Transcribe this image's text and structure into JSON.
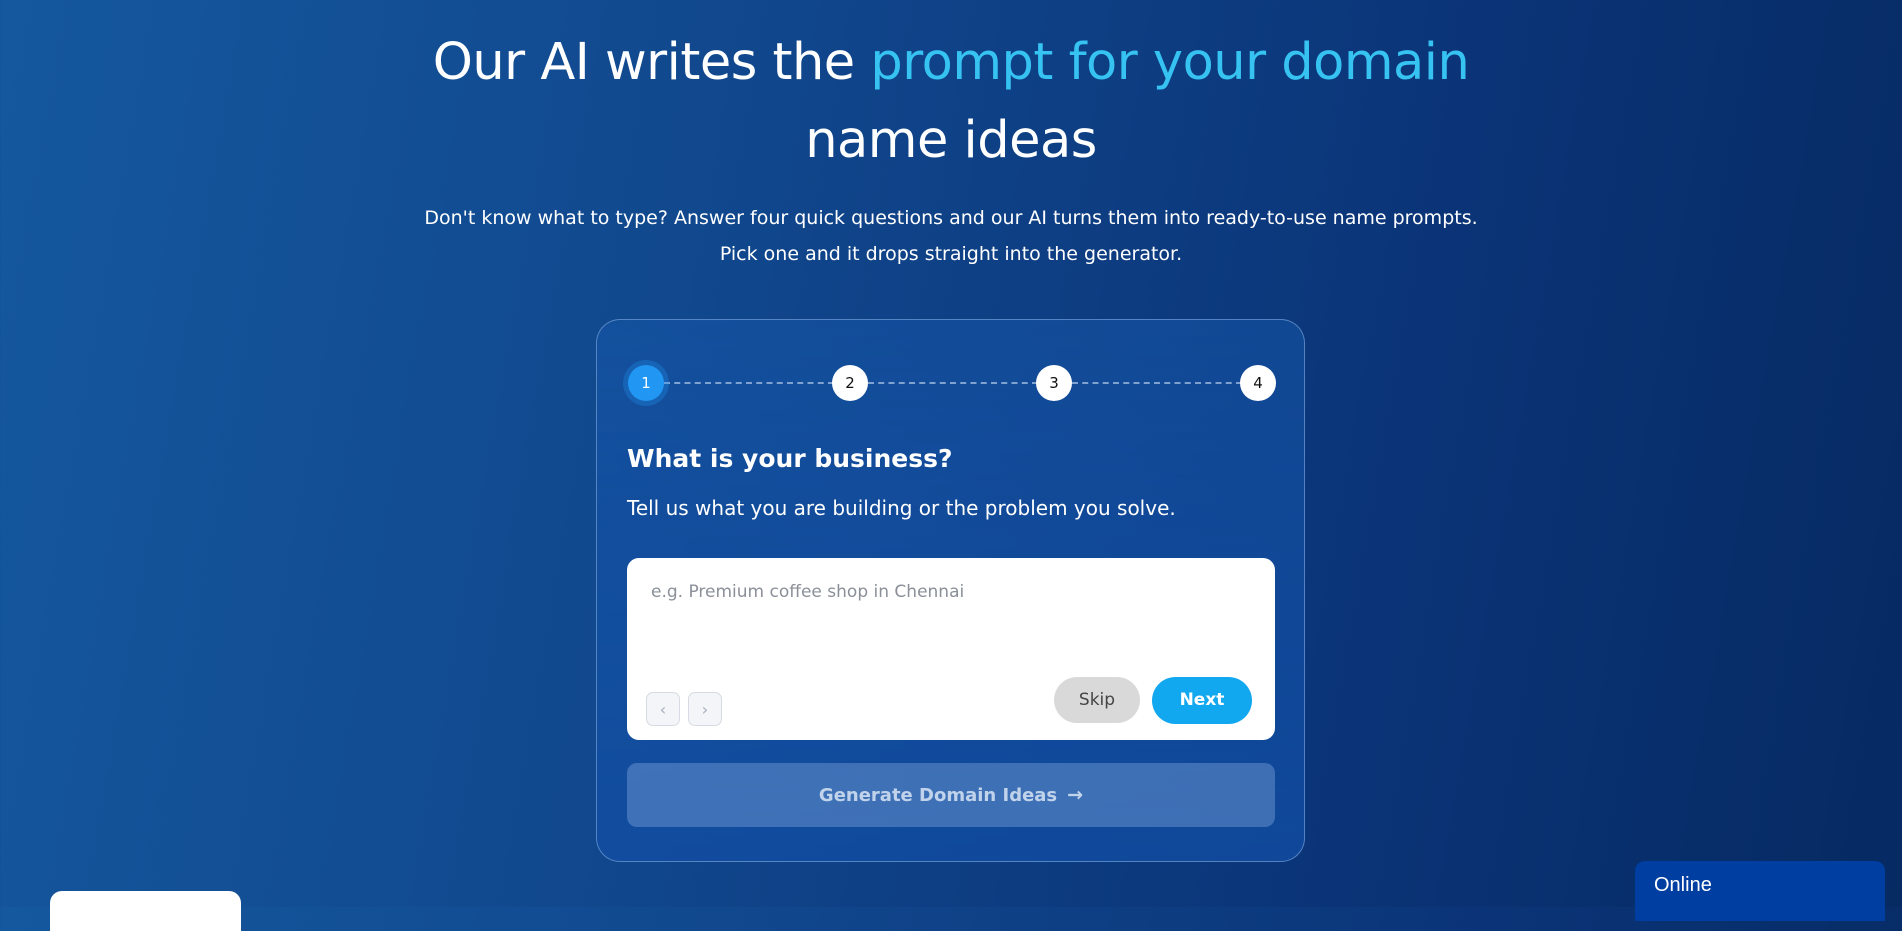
{
  "hero": {
    "title_part1": "Our AI writes the ",
    "title_accent": "prompt for your domain",
    "title_part2": "name ideas",
    "subtitle_line1": "Don't know what to type? Answer four quick questions and our AI turns them into ready-to-use name prompts.",
    "subtitle_line2": "Pick one and it drops straight into the generator."
  },
  "stepper": {
    "steps": [
      "1",
      "2",
      "3",
      "4"
    ],
    "active_step": 1
  },
  "question": {
    "title": "What is your business?",
    "subtitle": "Tell us what you are building or the problem you solve."
  },
  "input": {
    "value": "",
    "placeholder": "e.g. Premium coffee shop in Chennai"
  },
  "buttons": {
    "prev_icon": "‹",
    "next_icon": "›",
    "skip_label": "Skip",
    "next_label": "Next",
    "generate_label": "Generate Domain Ideas",
    "generate_arrow": "→"
  },
  "chat": {
    "status_label": "Online"
  },
  "colors": {
    "accent": "#36c3f2",
    "active_step": "#2196f3",
    "next_button": "#12a8ef",
    "chat_widget": "#003ea1"
  }
}
